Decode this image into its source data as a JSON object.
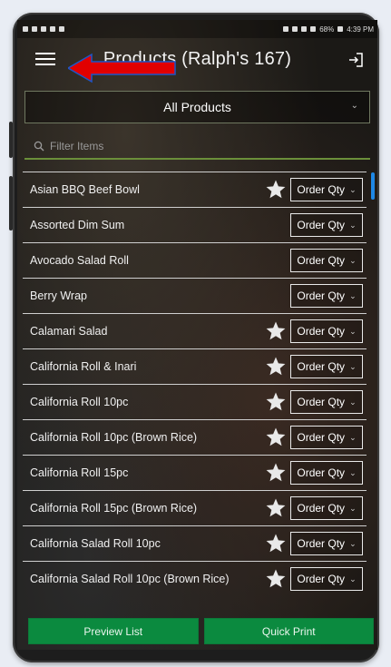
{
  "statusbar": {
    "battery": "68%",
    "time": "4:39 PM"
  },
  "header": {
    "title": "Products (Ralph's 167)"
  },
  "dropdown": {
    "selected": "All Products"
  },
  "filter": {
    "placeholder": "Filter Items"
  },
  "list": {
    "order_label": "Order Qty",
    "items": [
      {
        "label": "Asian BBQ Beef Bowl",
        "starred": true
      },
      {
        "label": "Assorted Dim Sum",
        "starred": false
      },
      {
        "label": "Avocado Salad Roll",
        "starred": false
      },
      {
        "label": "Berry Wrap",
        "starred": false
      },
      {
        "label": "Calamari Salad",
        "starred": true
      },
      {
        "label": "California Roll & Inari",
        "starred": true
      },
      {
        "label": "California Roll 10pc",
        "starred": true
      },
      {
        "label": "California Roll 10pc (Brown Rice)",
        "starred": true
      },
      {
        "label": "California Roll 15pc",
        "starred": true
      },
      {
        "label": "California Roll 15pc (Brown Rice)",
        "starred": true
      },
      {
        "label": "California Salad Roll 10pc",
        "starred": true
      },
      {
        "label": "California Salad Roll 10pc (Brown Rice)",
        "starred": true
      }
    ]
  },
  "bottom": {
    "preview_label": "Preview List",
    "print_label": "Quick Print"
  },
  "colors": {
    "accent": "#0b8a3f",
    "scroll": "#1e88e5",
    "arrow": "#e10000"
  }
}
